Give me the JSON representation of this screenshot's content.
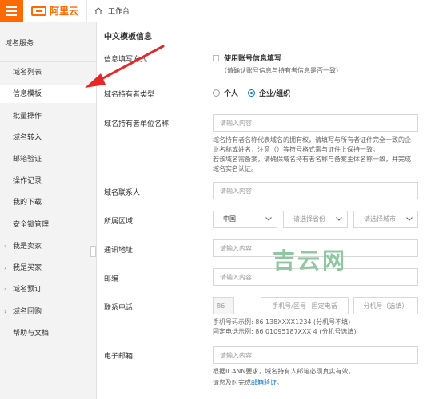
{
  "header": {
    "brand": "阿里云",
    "workbench": "工作台"
  },
  "sidebar": {
    "title": "域名服务",
    "items": [
      {
        "label": "域名列表",
        "active": false,
        "expandable": false
      },
      {
        "label": "信息模板",
        "active": true,
        "expandable": false
      },
      {
        "label": "批量操作",
        "active": false,
        "expandable": false
      },
      {
        "label": "域名转入",
        "active": false,
        "expandable": false
      },
      {
        "label": "邮箱验证",
        "active": false,
        "expandable": false
      },
      {
        "label": "操作记录",
        "active": false,
        "expandable": false
      },
      {
        "label": "我的下载",
        "active": false,
        "expandable": false
      },
      {
        "label": "安全锁管理",
        "active": false,
        "expandable": false
      },
      {
        "label": "我是卖家",
        "active": false,
        "expandable": true
      },
      {
        "label": "我是买家",
        "active": false,
        "expandable": true
      },
      {
        "label": "域名预订",
        "active": false,
        "expandable": true
      },
      {
        "label": "域名回购",
        "active": false,
        "expandable": true
      },
      {
        "label": "帮助与文档",
        "active": false,
        "expandable": false
      }
    ]
  },
  "form": {
    "section_title": "中文模板信息",
    "fill_method": {
      "label": "信息填写方式",
      "checkbox_label": "使用账号信息填写",
      "checked": false,
      "hint": "（请确认账号信息与持有者信息是否一致）"
    },
    "holder_type": {
      "label": "域名持有者类型",
      "options": [
        "个人",
        "企业/组织"
      ],
      "selected": "企业/组织"
    },
    "org_name": {
      "label": "域名持有者单位名称",
      "placeholder": "请输入内容",
      "tips": [
        "域名持有者名称代表域名的拥有权，请填写与所有者证件完全一致的企",
        "业名称或姓名，注意（）等符号格式需与证件上保持一致。",
        "若该域名需备案，请确保域名持有者名称与备案主体名称一致，并完成",
        "域名实名认证。"
      ]
    },
    "contact": {
      "label": "域名联系人",
      "placeholder": "请输入内容"
    },
    "region": {
      "label": "所属区域",
      "country": "中国",
      "province_placeholder": "请选择省份",
      "city_placeholder": "请选择城市"
    },
    "address": {
      "label": "通讯地址",
      "placeholder": "请输入内容"
    },
    "postcode": {
      "label": "邮编",
      "placeholder": "请输入内容"
    },
    "phone": {
      "label": "联系电话",
      "country_code": "86",
      "number_placeholder": "手机号/区号+固定电话",
      "ext_placeholder": "分机号（选填）",
      "example_mobile": "手机号码示例: 86 138XXXX1234    (分机号不填)",
      "example_fixed": "固定电话示例: 86 01095187XXX 4  (分机号选填)"
    },
    "email": {
      "label": "电子邮箱",
      "placeholder": "请输入内容",
      "note_line1": "根据ICANN要求，域名持有人邮箱必须真实有效，",
      "note_line2_prefix": "请您及时完成",
      "note_link": "邮箱验证",
      "note_line2_suffix": "。"
    }
  },
  "watermark": "吉云网",
  "colors": {
    "brand": "#ff6a00",
    "accent": "#0070cc",
    "arrow": "#e8262a"
  }
}
